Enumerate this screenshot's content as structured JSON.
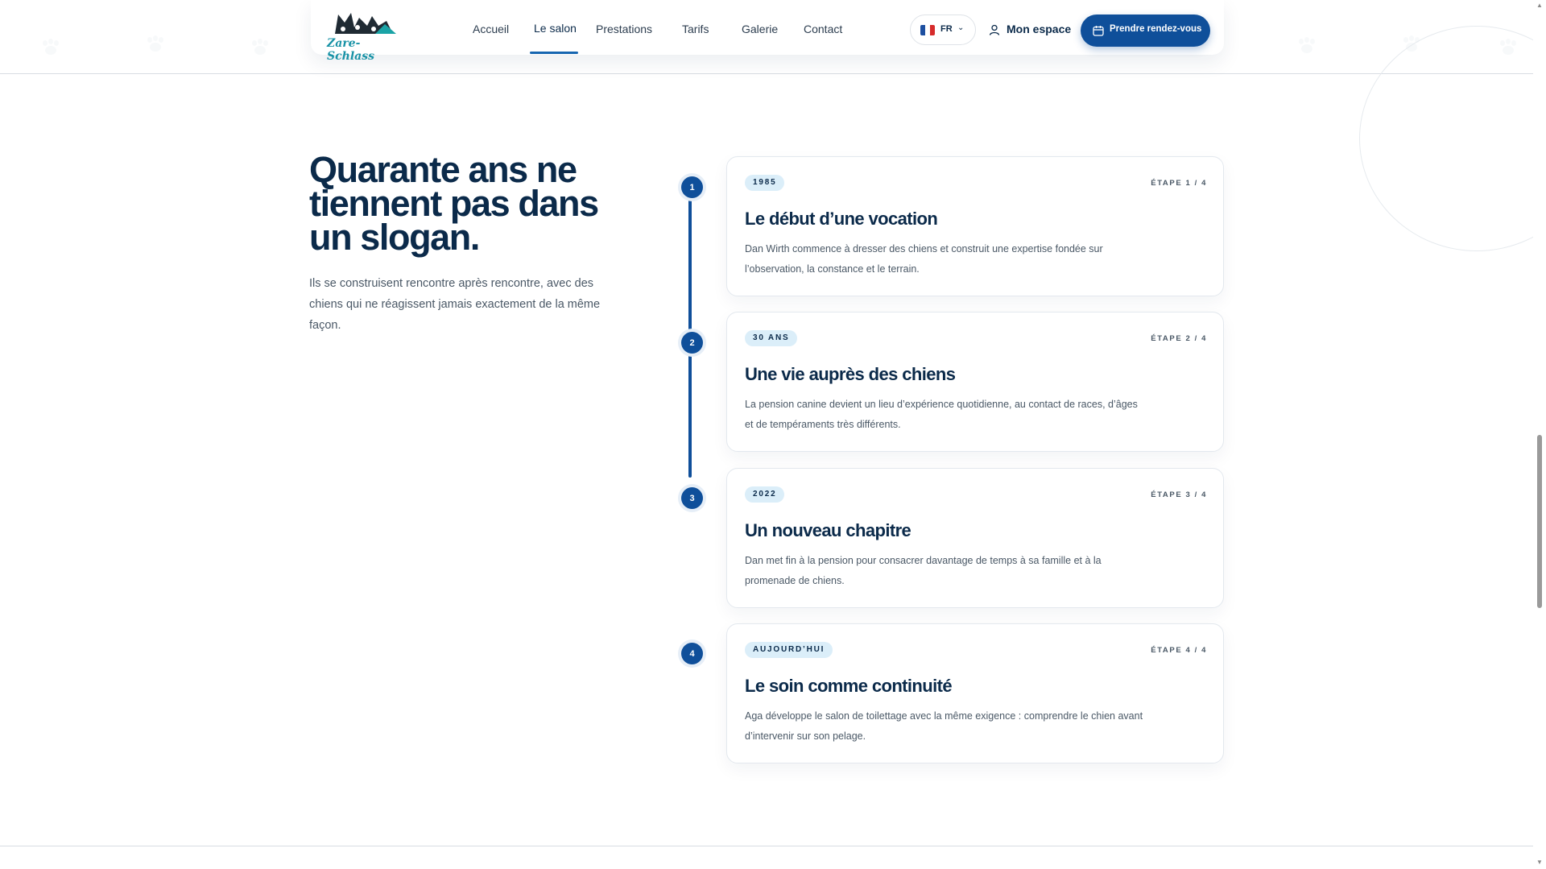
{
  "header": {
    "logo_text": "Zare-Schlass",
    "nav": [
      {
        "label": "Accueil"
      },
      {
        "label": "Le salon",
        "active": true
      },
      {
        "label": "Prestations"
      },
      {
        "label": "Tarifs"
      },
      {
        "label": "Galerie"
      },
      {
        "label": "Contact"
      }
    ],
    "language": {
      "code": "FR",
      "flag": "france-flag-icon"
    },
    "account_label": "Mon espace",
    "cta_label": "Prendre rendez-vous"
  },
  "intro": {
    "title": "Quarante ans ne tiennent pas dans un slogan.",
    "text": "Ils se construisent rencontre après rencontre, avec des chiens qui ne réagissent jamais exactement de la même façon."
  },
  "timeline": [
    {
      "number": "1",
      "badge": "1985",
      "step": "ÉTAPE 1 / 4",
      "title": "Le début d’une vocation",
      "text": "Dan Wirth commence à dresser des chiens et construit une expertise fondée sur l’observation, la constance et le terrain."
    },
    {
      "number": "2",
      "badge": "30 ANS",
      "step": "ÉTAPE 2 / 4",
      "title": "Une vie auprès des chiens",
      "text": "La pension canine devient un lieu d’expérience quotidienne, au contact de races, d’âges et de tempéraments très différents."
    },
    {
      "number": "3",
      "badge": "2022",
      "step": "ÉTAPE 3 / 4",
      "title": "Un nouveau chapitre",
      "text": "Dan met fin à la pension pour consacrer davantage de temps à sa famille et à la promenade de chiens."
    },
    {
      "number": "4",
      "badge": "AUJOURD’HUI",
      "step": "ÉTAPE 4 / 4",
      "title": "Le soin comme continuité",
      "text": "Aga développe le salon de toilettage avec la même exigence : comprendre le chien avant d’intervenir sur son pelage."
    }
  ],
  "colors": {
    "primary": "#0f4f9a",
    "heading": "#0b2a4a",
    "badge_bg": "#dbeef9",
    "body_text": "#4a5866"
  }
}
